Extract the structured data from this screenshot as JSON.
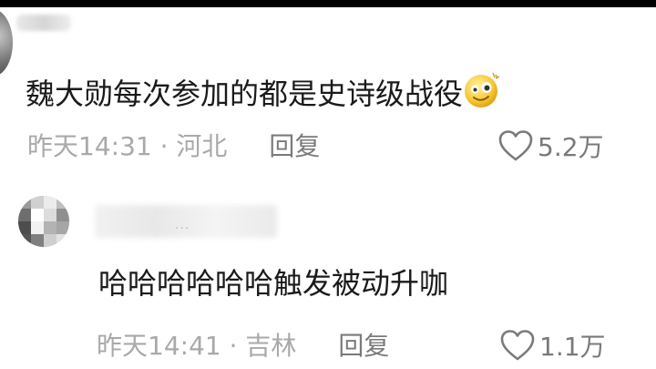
{
  "comments": [
    {
      "text": "魏大勋每次参加的都是史诗级战役",
      "emoji": "smiling-face-with-sparkle-eye-icon",
      "time": "昨天14:31",
      "separator": " · ",
      "location": "河北",
      "reply_label": "回复",
      "likes": "5.2万"
    },
    {
      "name_suffix": "···",
      "text": "哈哈哈哈哈哈触发被动升咖",
      "time": "昨天14:41",
      "separator": " · ",
      "location": "吉林",
      "reply_label": "回复",
      "likes": "1.1万"
    }
  ],
  "colors": {
    "text": "#1a1a1a",
    "meta": "#a9a9a9",
    "action": "#7a7a7a",
    "background": "#ffffff"
  }
}
